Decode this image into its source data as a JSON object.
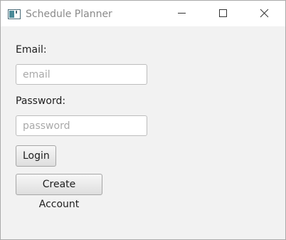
{
  "window": {
    "title": "Schedule Planner",
    "controls": [
      "minimize-icon",
      "maximize-icon",
      "close-icon"
    ]
  },
  "form": {
    "email_label": "Email:",
    "email_placeholder": "email",
    "email_value": "",
    "password_label": "Password:",
    "password_placeholder": "password",
    "password_value": "",
    "login_label": "Login",
    "create_account_label": "Create Account"
  },
  "colors": {
    "title_text": "#8a8a8a",
    "background": "#f2f2f2",
    "titlebar": "#ffffff"
  }
}
